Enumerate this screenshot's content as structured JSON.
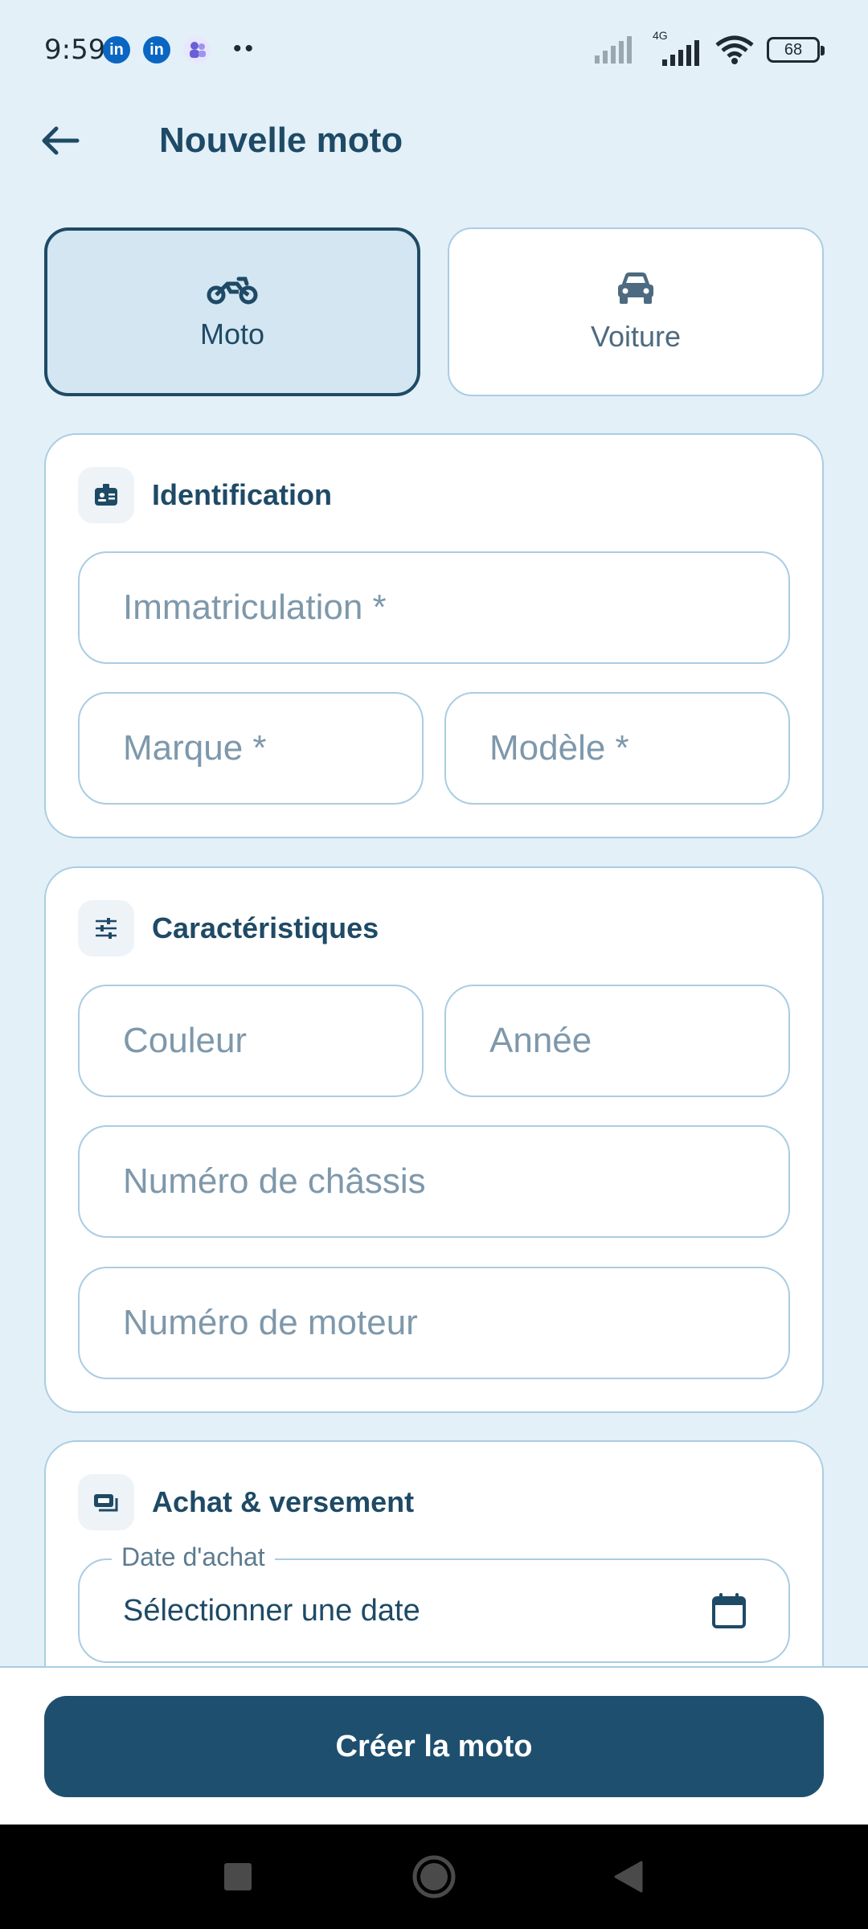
{
  "status": {
    "time": "9:59",
    "network_label": "4G",
    "battery": "68"
  },
  "header": {
    "title": "Nouvelle moto"
  },
  "vehicle_types": [
    {
      "label": "Moto",
      "icon": "motorcycle-icon",
      "selected": true
    },
    {
      "label": "Voiture",
      "icon": "car-icon",
      "selected": false
    }
  ],
  "identification": {
    "title": "Identification",
    "registration_placeholder": "Immatriculation *",
    "brand_placeholder": "Marque *",
    "model_placeholder": "Modèle *"
  },
  "characteristics": {
    "title": "Caractéristiques",
    "color_placeholder": "Couleur",
    "year_placeholder": "Année",
    "chassis_placeholder": "Numéro de châssis",
    "engine_placeholder": "Numéro de moteur"
  },
  "purchase": {
    "title": "Achat & versement",
    "date_label": "Date d'achat",
    "date_value": "Sélectionner une date"
  },
  "actions": {
    "create_label": "Créer la moto"
  },
  "colors": {
    "primary": "#1e4f6f",
    "background": "#e3f0f8",
    "border": "#a9cde3"
  }
}
